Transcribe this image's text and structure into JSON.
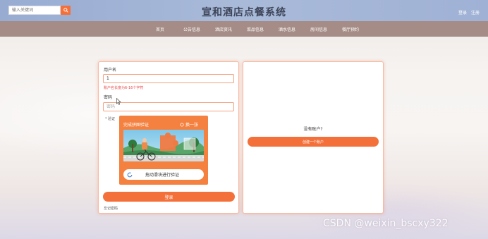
{
  "header": {
    "search_placeholder": "输入关键词",
    "site_title": "宣和酒店点餐系统",
    "login_link": "登录",
    "register_link": "注册"
  },
  "nav": {
    "items": [
      "首页",
      "公告信息",
      "酒店资讯",
      "菜品信息",
      "酒水信息",
      "房间信息",
      "餐厅预约"
    ]
  },
  "login_form": {
    "username_label": "用户名",
    "username_value": "1",
    "username_hint": "账户名长度为6-16个字符",
    "password_label": "密码",
    "password_placeholder": "密码",
    "captcha_label": "* 验证",
    "login_button": "登录",
    "forgot_link": "忘记密码"
  },
  "captcha": {
    "title": "完成拼图验证",
    "refresh_label": "换一张",
    "slider_text": "拖动滑块进行验证"
  },
  "register_panel": {
    "no_account_text": "没有账户?",
    "create_button": "创建一个账户"
  },
  "watermark": "CSDN @weixin_bscxy322",
  "colors": {
    "accent": "#f4703a",
    "topbar": "#a9bad9",
    "navbar": "#a58c86"
  }
}
